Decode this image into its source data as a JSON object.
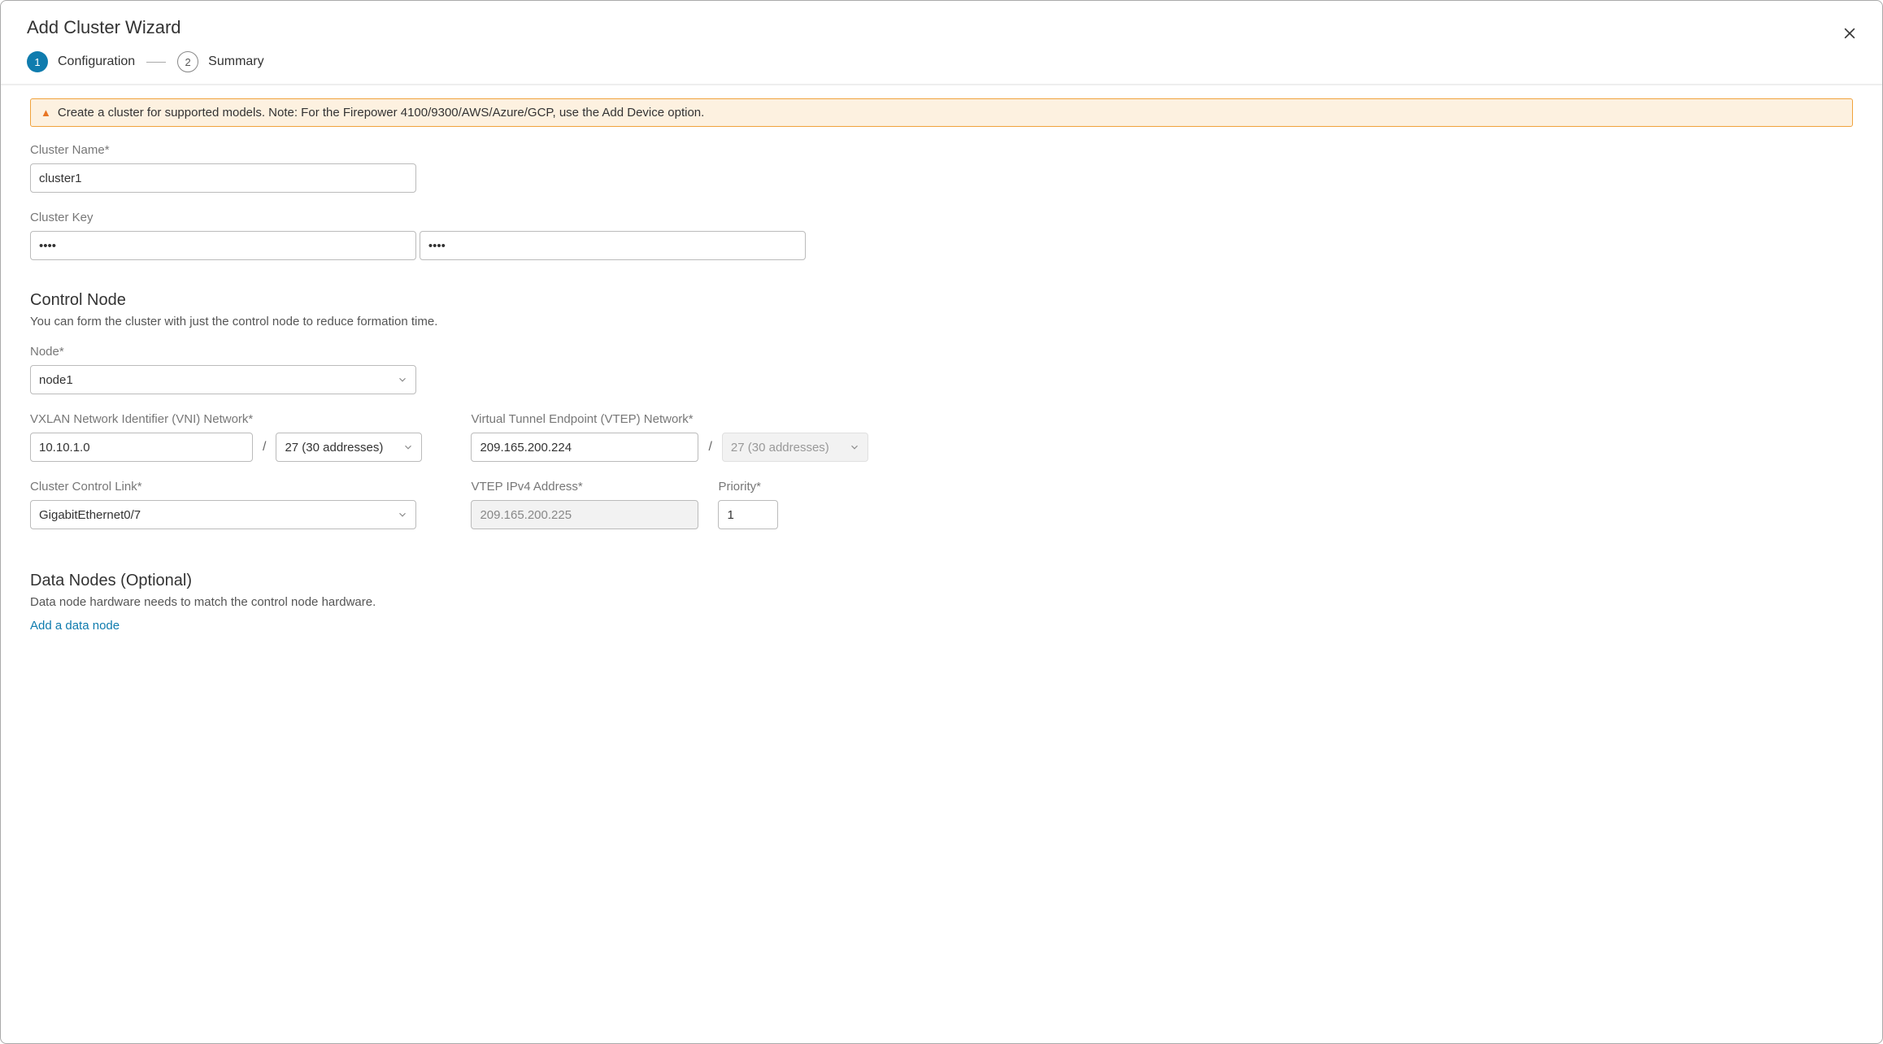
{
  "title": "Add Cluster Wizard",
  "steps": {
    "step1_number": "1",
    "step1_label": "Configuration",
    "step2_number": "2",
    "step2_label": "Summary"
  },
  "banner": "Create a cluster for supported models. Note: For the Firepower 4100/9300/AWS/Azure/GCP, use the Add Device option.",
  "cluster_name": {
    "label": "Cluster Name*",
    "value": "cluster1"
  },
  "cluster_key": {
    "label": "Cluster Key",
    "value1": "••••",
    "value2": "••••"
  },
  "control_node": {
    "heading": "Control Node",
    "desc": "You can form the cluster with just the control node to reduce formation time.",
    "node_label": "Node*",
    "node_value": "node1",
    "vni_label": "VXLAN Network Identifier (VNI) Network*",
    "vni_value": "10.10.1.0",
    "vni_prefix": "27 (30 addresses)",
    "vtep_label": "Virtual Tunnel Endpoint (VTEP) Network*",
    "vtep_value": "209.165.200.224",
    "vtep_prefix": "27 (30 addresses)",
    "ccl_label": "Cluster Control Link*",
    "ccl_value": "GigabitEthernet0/7",
    "vtep_addr_label": "VTEP IPv4 Address*",
    "vtep_addr_value": "209.165.200.225",
    "priority_label": "Priority*",
    "priority_value": "1"
  },
  "data_nodes": {
    "heading": "Data Nodes (Optional)",
    "desc": "Data node hardware needs to match the control node hardware.",
    "add_link": "Add a data node"
  }
}
